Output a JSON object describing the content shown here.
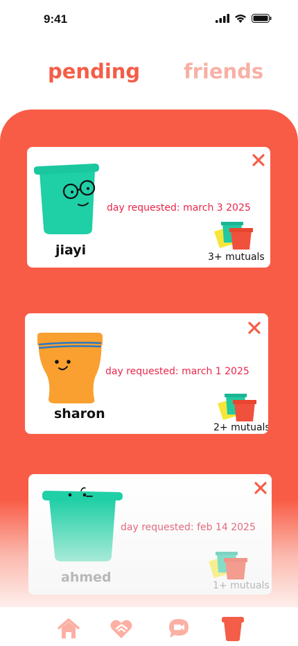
{
  "status_bar": {
    "time": "9:41",
    "icons": [
      "signal-icon",
      "wifi-icon",
      "battery-icon"
    ]
  },
  "tabs": [
    {
      "label": "pending",
      "active": true
    },
    {
      "label": "friends",
      "active": false
    }
  ],
  "requests": [
    {
      "name": "jiayi",
      "date": "day requested: march 3 2025",
      "mutuals": "3+ mutuals",
      "avatar": "green-bucket-with-glasses"
    },
    {
      "name": "sharon",
      "date": "day requested: march 1 2025",
      "mutuals": "2+ mutuals",
      "avatar": "orange-bucket-with-headband"
    },
    {
      "name": "ahmed",
      "date": "day requested: feb 14 2025",
      "mutuals": "1+ mutuals",
      "avatar": "green-bucket-sleepy"
    }
  ],
  "bottom_nav": [
    {
      "icon": "home-icon"
    },
    {
      "icon": "heart-handshake-icon"
    },
    {
      "icon": "video-chat-icon"
    },
    {
      "icon": "bucket-icon",
      "active": true
    }
  ],
  "colors": {
    "accent": "#f95c46",
    "tab_inactive": "#f8b0a5",
    "date_text": "#e8264a",
    "green_bucket": "#1fcfa5",
    "orange_bucket": "#f9a030",
    "nav_icon": "#fbb0a3"
  }
}
